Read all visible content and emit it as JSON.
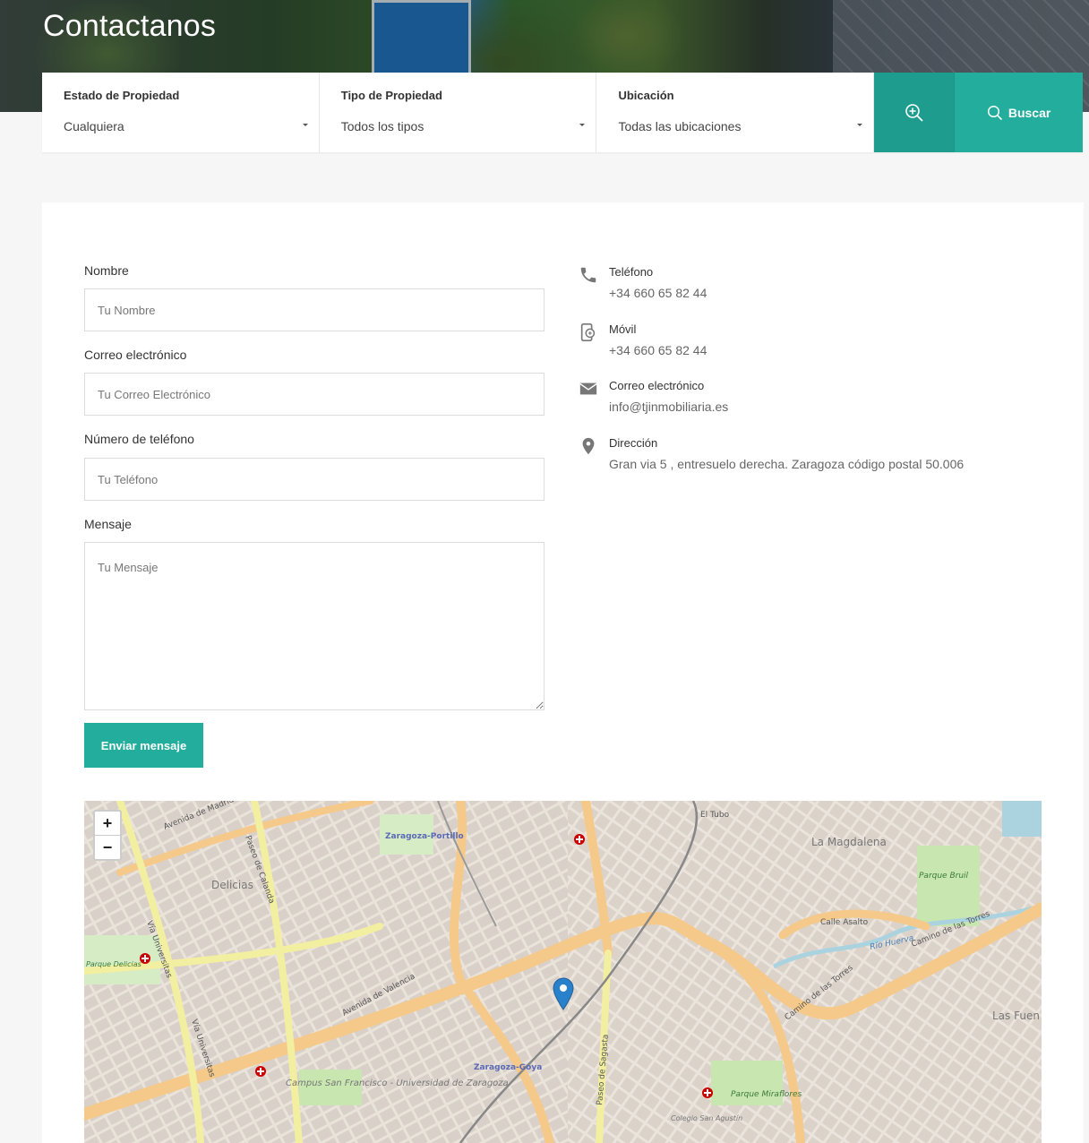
{
  "hero": {
    "title": "Contactanos"
  },
  "search": {
    "status": {
      "label": "Estado de Propiedad",
      "value": "Cualquiera"
    },
    "type": {
      "label": "Tipo de Propiedad",
      "value": "Todos los tipos"
    },
    "location": {
      "label": "Ubicación",
      "value": "Todas las ubicaciones"
    },
    "button_label": "Buscar"
  },
  "form": {
    "name_label": "Nombre",
    "name_placeholder": "Tu Nombre",
    "email_label": "Correo electrónico",
    "email_placeholder": "Tu Correo Electrónico",
    "phone_label": "Número de teléfono",
    "phone_placeholder": "Tu Teléfono",
    "message_label": "Mensaje",
    "message_placeholder": "Tu Mensaje",
    "submit_label": "Enviar mensaje"
  },
  "contact": {
    "phone": {
      "title": "Teléfono",
      "value": "+34 660 65 82 44",
      "icon": "phone-icon"
    },
    "mobile": {
      "title": "Móvil",
      "value": "+34 660 65 82 44",
      "icon": "mobile-icon"
    },
    "email": {
      "title": "Correo electrónico",
      "value": "info@tjinmobiliaria.es",
      "icon": "mail-icon"
    },
    "address": {
      "title": "Dirección",
      "value": "Gran via 5 , entresuelo derecha. Zaragoza código postal 50.006",
      "icon": "map-pin-icon"
    }
  },
  "map": {
    "zoom_in": "+",
    "zoom_out": "−",
    "labels": {
      "avenida_madrid": "Avenida de Madrid",
      "zaragoza_portillo": "Zaragoza-Portillo",
      "delicias": "Delicias",
      "la_magdalena": "La Magdalena",
      "parque_bruil": "Parque Bruil",
      "calle_asalto": "Calle Asalto",
      "rio_huerva": "Río Huerva",
      "camino_torres_1": "Camino de las Torres",
      "camino_torres_2": "Camino de las Torres",
      "avenida_valencia": "Avenida de Valencia",
      "via_universitas_1": "Vía Universitas",
      "via_universitas_2": "Vía Universitas",
      "parque_delicias": "Parque Delicias",
      "zaragoza_goya": "Zaragoza-Goya",
      "paseo_sagasta": "Paseo de Sagasta",
      "paseo_calanda": "Paseo de Calanda",
      "campus": "Campus San Francisco - Universidad de Zaragoza",
      "las_fuentes": "Las Fuen",
      "el_tubo": "El Tubo",
      "parque_miraflores": "Parque Miraflores",
      "colegio": "Colegio San Agustín"
    },
    "colors": {
      "major_road": "#f5c98a",
      "secondary_road": "#f3efa0",
      "park": "#c8e6b0",
      "water": "#aad3df",
      "marker": "#2a81cb"
    }
  },
  "colors": {
    "accent": "#23ad9c",
    "accent_dark": "#1e9d8e"
  }
}
